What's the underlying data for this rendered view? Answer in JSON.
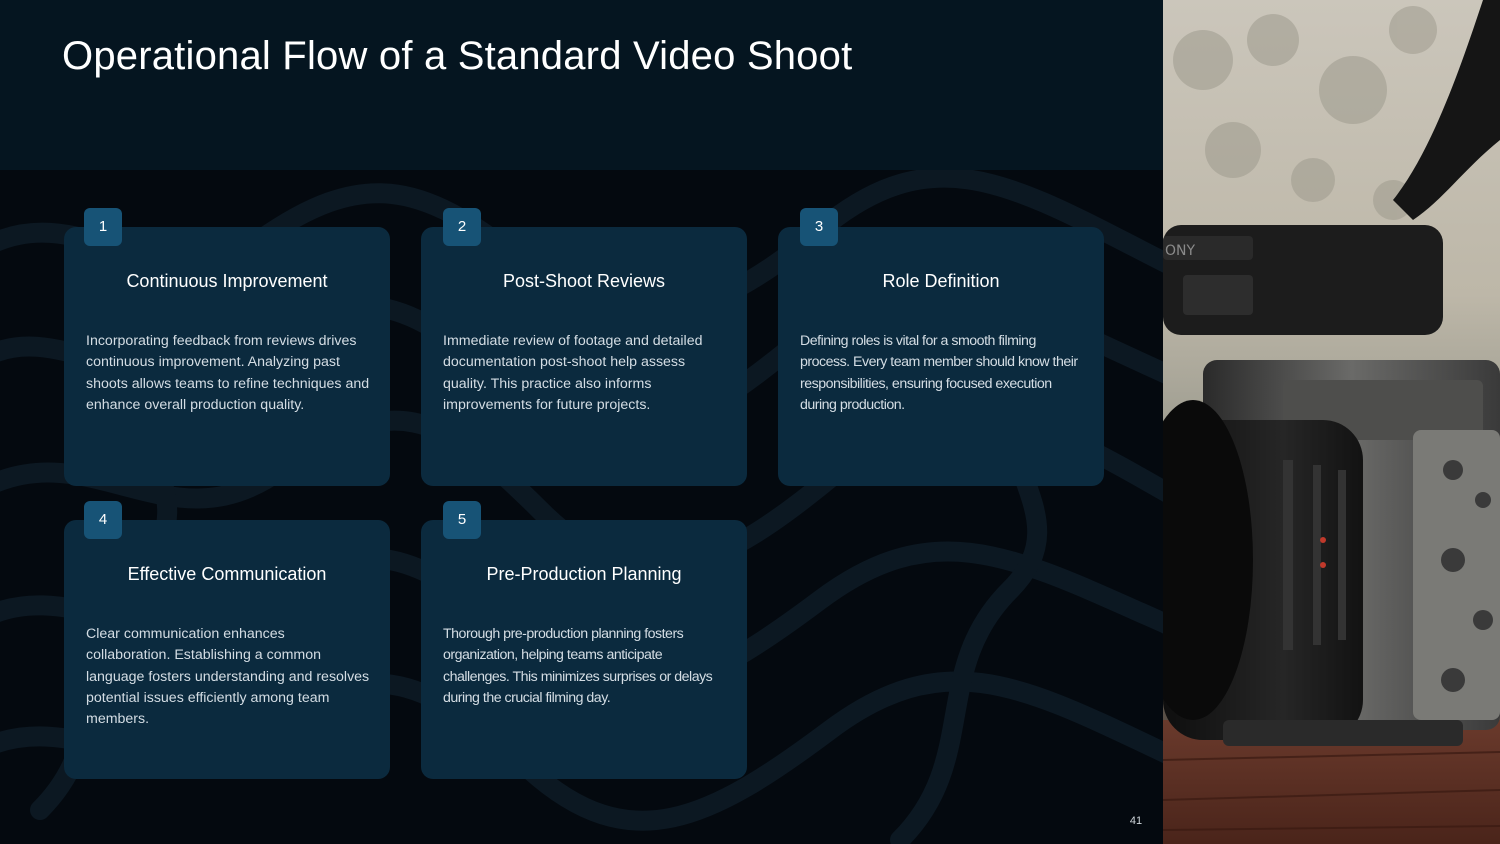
{
  "slide": {
    "title": "Operational Flow of a Standard Video Shoot",
    "page_number": "41"
  },
  "cards": [
    {
      "number": "1",
      "title": "Continuous Improvement",
      "body": "Incorporating feedback from reviews drives continuous improvement. Analyzing past shoots allows teams to refine techniques and enhance overall production quality."
    },
    {
      "number": "2",
      "title": "Post-Shoot Reviews",
      "body": "Immediate review of footage and detailed documentation post-shoot help assess quality. This practice also informs improvements for future projects."
    },
    {
      "number": "3",
      "title": "Role Definition",
      "body": "Defining roles is vital for a smooth filming process. Every team member should know their responsibilities, ensuring focused execution during production."
    },
    {
      "number": "4",
      "title": "Effective Communication",
      "body": "Clear communication enhances collaboration. Establishing a common language fosters understanding and resolves potential issues efficiently among team members."
    },
    {
      "number": "5",
      "title": "Pre-Production Planning",
      "body": "Thorough pre-production planning fosters organization, helping teams anticipate challenges. This minimizes surprises or delays during the crucial filming day."
    }
  ],
  "colors": {
    "background": "#04090f",
    "header": "#051520",
    "card": "#0b2a3e",
    "badge": "#175376",
    "text": "#ffffff"
  },
  "image": {
    "icon": "video-camera-photo"
  }
}
